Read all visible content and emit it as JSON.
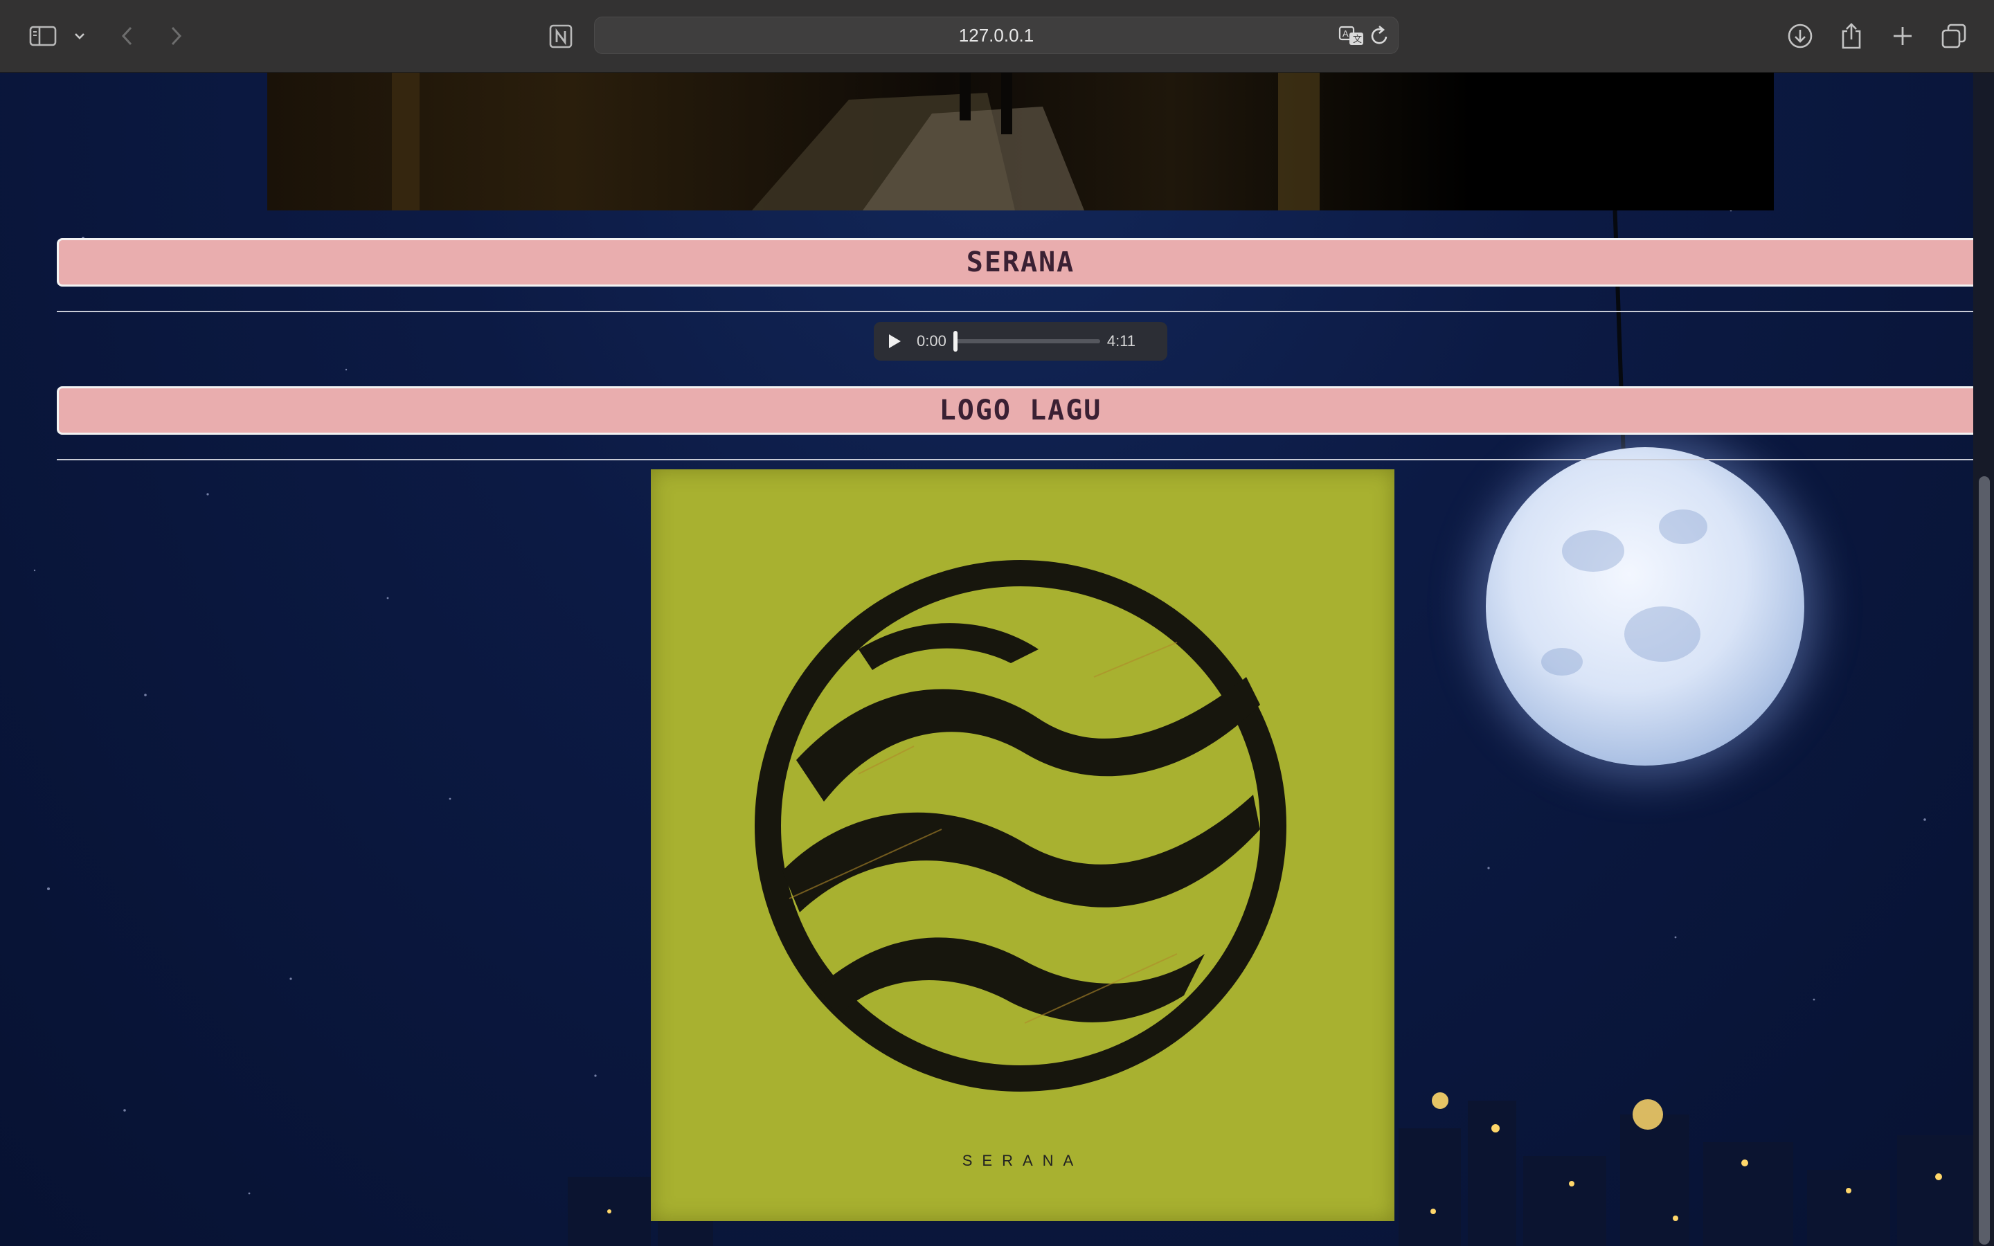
{
  "browser": {
    "url": "127.0.0.1",
    "icons": {
      "sidebar": "sidebar-icon",
      "tab_menu": "chevron-down-icon",
      "back": "chevron-left-icon",
      "forward": "chevron-right-icon",
      "notion": "notion-icon",
      "translate": "translate-icon",
      "reload": "reload-icon",
      "downloads": "download-icon",
      "share": "share-icon",
      "new_tab": "plus-icon",
      "tabs_overview": "tabs-icon"
    }
  },
  "page": {
    "song_title": "SERANA",
    "audio": {
      "current_time": "0:00",
      "duration": "4:11",
      "progress": 0
    },
    "logo_section_title": "LOGO LAGU",
    "cover_caption": "SERANA"
  },
  "colors": {
    "section_bar_bg": "#e9adae",
    "section_bar_text": "#3a2033",
    "cover_bg": "#a8b130",
    "night_sky": "#0c1a44"
  }
}
